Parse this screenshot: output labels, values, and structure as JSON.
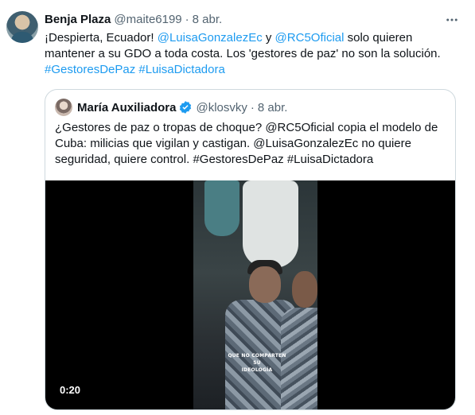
{
  "tweet": {
    "author_name": "Benja Plaza",
    "author_handle": "@maite6199",
    "separator": "·",
    "date": "8 abr.",
    "text_parts": [
      "¡Despierta, Ecuador! ",
      "@LuisaGonzalezEc",
      " y ",
      "@RC5Oficial",
      " solo quieren mantener a su GDO a toda costa. Los 'gestores de paz' no son la solución. ",
      "#GestoresDePaz",
      " ",
      "#LuisaDictadora"
    ]
  },
  "quote": {
    "author_name": "María Auxiliadora",
    "author_handle": "@klosvky",
    "separator": "·",
    "date": "8 abr.",
    "text": "¿Gestores  de paz o tropas de choque? @RC5Oficial copia el modelo de Cuba:  milicias que vigilan y castigan. @LuisaGonzalezEc no quiere seguridad,  quiere control. #GestoresDePaz #LuisaDictadora",
    "video": {
      "caption_line1": "QUE NO COMPARTEN SU",
      "caption_line2": "IDEOLOGÍA",
      "duration": "0:20"
    }
  },
  "icons": {
    "more": "more-horizontal-icon",
    "verified": "verified-badge-icon"
  },
  "colors": {
    "link": "#1d9bf0",
    "secondary_text": "#536471",
    "border": "#cfd9de",
    "verified": "#1d9bf0"
  }
}
